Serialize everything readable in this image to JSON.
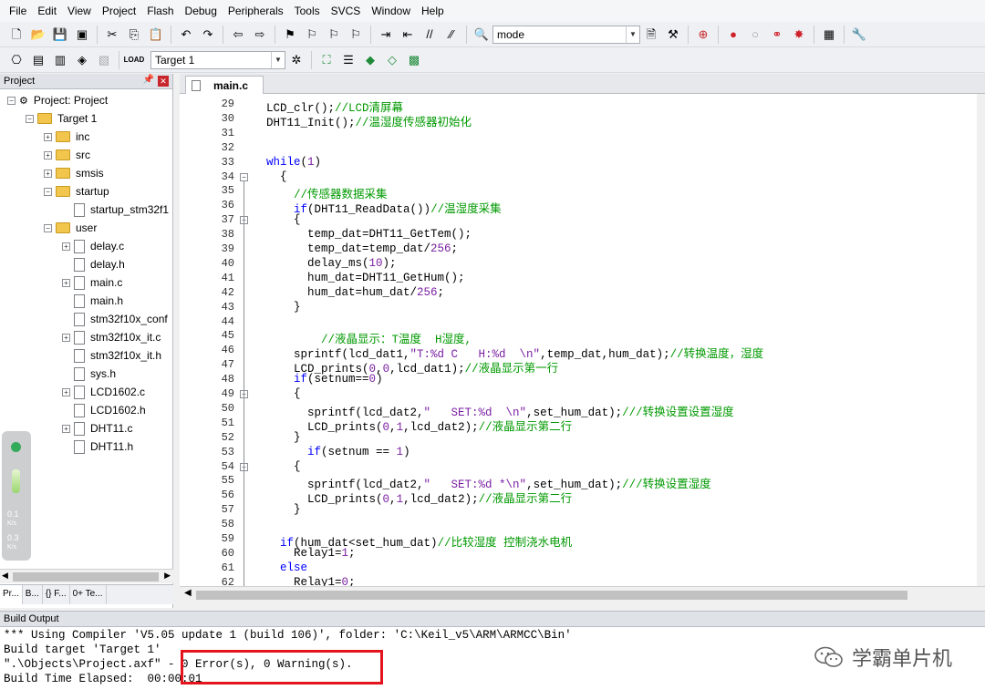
{
  "menu": [
    "File",
    "Edit",
    "View",
    "Project",
    "Flash",
    "Debug",
    "Peripherals",
    "Tools",
    "SVCS",
    "Window",
    "Help"
  ],
  "toolbar": {
    "search_text": "mode",
    "target": "Target 1"
  },
  "project": {
    "header": "Project",
    "root": "Project: Project",
    "target": "Target 1",
    "groups": [
      "inc",
      "src",
      "smsis",
      "startup",
      "startup_stm32f1",
      "user"
    ],
    "files": [
      "delay.c",
      "delay.h",
      "main.c",
      "main.h",
      "stm32f10x_conf",
      "stm32f10x_it.c",
      "stm32f10x_it.h",
      "sys.h",
      "LCD1602.c",
      "LCD1602.h",
      "DHT11.c",
      "DHT11.h"
    ],
    "tabs": [
      "Pr...",
      "B...",
      "{} F...",
      "0+ Te..."
    ]
  },
  "speed": {
    "up": "0.1",
    "up_unit": "K/s",
    "down": "0.3",
    "down_unit": "K/s"
  },
  "editor": {
    "tab": "main.c",
    "lines": [
      {
        "n": "29",
        "t": "LCD_clr();//LCD清屏幕"
      },
      {
        "n": "30",
        "t": "DHT11_Init();//温湿度传感器初始化"
      },
      {
        "n": "31",
        "t": ""
      },
      {
        "n": "32",
        "t": ""
      },
      {
        "n": "33",
        "t": "while(1)"
      },
      {
        "n": "34",
        "t": "  {"
      },
      {
        "n": "35",
        "t": "    //传感器数据采集"
      },
      {
        "n": "36",
        "t": "    if(DHT11_ReadData())//温湿度采集"
      },
      {
        "n": "37",
        "t": "    {"
      },
      {
        "n": "38",
        "t": "      temp_dat=DHT11_GetTem();"
      },
      {
        "n": "39",
        "t": "      temp_dat=temp_dat/256;"
      },
      {
        "n": "40",
        "t": "      delay_ms(10);"
      },
      {
        "n": "41",
        "t": "      hum_dat=DHT11_GetHum();"
      },
      {
        "n": "42",
        "t": "      hum_dat=hum_dat/256;"
      },
      {
        "n": "43",
        "t": "    }"
      },
      {
        "n": "44",
        "t": ""
      },
      {
        "n": "45",
        "t": "        //液晶显示：T温度  H湿度,"
      },
      {
        "n": "46",
        "t": "    sprintf(lcd_dat1,\"T:%d C   H:%d  \\n\",temp_dat,hum_dat);//转换温度，湿度"
      },
      {
        "n": "47",
        "t": "    LCD_prints(0,0,lcd_dat1);//液晶显示第一行"
      },
      {
        "n": "48",
        "t": "    if(setnum==0)"
      },
      {
        "n": "49",
        "t": "    {"
      },
      {
        "n": "50",
        "t": "      sprintf(lcd_dat2,\"   SET:%d  \\n\",set_hum_dat);///转换设置设置湿度"
      },
      {
        "n": "51",
        "t": "      LCD_prints(0,1,lcd_dat2);//液晶显示第二行"
      },
      {
        "n": "52",
        "t": "    }"
      },
      {
        "n": "53",
        "t": "      if(setnum == 1)"
      },
      {
        "n": "54",
        "t": "    {"
      },
      {
        "n": "55",
        "t": "      sprintf(lcd_dat2,\"   SET:%d *\\n\",set_hum_dat);///转换设置湿度"
      },
      {
        "n": "56",
        "t": "      LCD_prints(0,1,lcd_dat2);//液晶显示第二行"
      },
      {
        "n": "57",
        "t": "    }"
      },
      {
        "n": "58",
        "t": ""
      },
      {
        "n": "59",
        "t": "  if(hum_dat<set_hum_dat)//比较湿度 控制浇水电机"
      },
      {
        "n": "60",
        "t": "    Relay1=1;"
      },
      {
        "n": "61",
        "t": "  else"
      },
      {
        "n": "62",
        "t": "    Relay1=0;"
      }
    ]
  },
  "build": {
    "header": "Build Output",
    "lines": [
      "*** Using Compiler 'V5.05 update 1 (build 106)', folder: 'C:\\Keil_v5\\ARM\\ARMCC\\Bin'",
      "Build target 'Target 1'",
      "\".\\Objects\\Project.axf\" - 0 Error(s), 0 Warning(s).",
      "Build Time Elapsed:  00:00:01"
    ]
  },
  "watermark": "学霸单片机",
  "colors": {
    "keyword": "#0000ff",
    "comment": "#009900",
    "number": "#7a1fa2",
    "highlight": "#e3141e"
  }
}
